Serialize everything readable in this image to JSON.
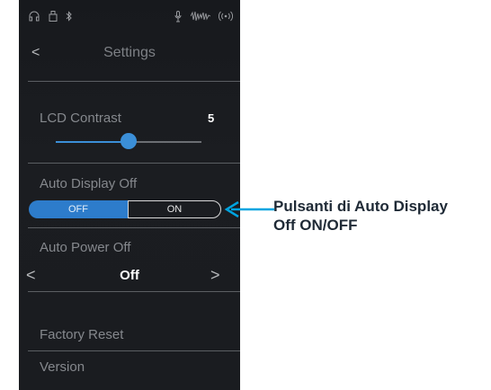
{
  "status_bar": {
    "icons": [
      "headphones-icon",
      "usb-storage-icon",
      "bluetooth-icon",
      "microphone-icon",
      "audio-waveform-icon",
      "wireless-signal-icon"
    ]
  },
  "header": {
    "back_glyph": "<",
    "title": "Settings"
  },
  "lcd_contrast": {
    "label": "LCD Contrast",
    "value": "5",
    "level_fraction": 0.5
  },
  "auto_display_off": {
    "label": "Auto Display Off",
    "options": [
      "OFF",
      "ON"
    ],
    "selected": "OFF"
  },
  "auto_power_off": {
    "label": "Auto Power Off",
    "value": "Off",
    "prev_glyph": "<",
    "next_glyph": ">"
  },
  "menu": {
    "factory_reset": "Factory Reset",
    "version": "Version"
  },
  "callout": {
    "line1": "Pulsanti di Auto Display",
    "line2": "Off ON/OFF",
    "color": "#00a4e0"
  },
  "colors": {
    "accent": "#3b8fd8",
    "screen_bg": "#1a1c20"
  }
}
